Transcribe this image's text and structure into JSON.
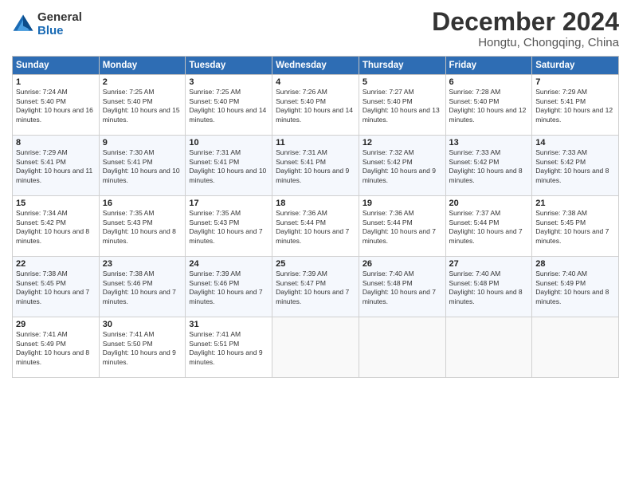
{
  "header": {
    "logo_general": "General",
    "logo_blue": "Blue",
    "title": "December 2024",
    "subtitle": "Hongtu, Chongqing, China"
  },
  "days_of_week": [
    "Sunday",
    "Monday",
    "Tuesday",
    "Wednesday",
    "Thursday",
    "Friday",
    "Saturday"
  ],
  "weeks": [
    [
      {
        "day": "1",
        "sunrise": "Sunrise: 7:24 AM",
        "sunset": "Sunset: 5:40 PM",
        "daylight": "Daylight: 10 hours and 16 minutes."
      },
      {
        "day": "2",
        "sunrise": "Sunrise: 7:25 AM",
        "sunset": "Sunset: 5:40 PM",
        "daylight": "Daylight: 10 hours and 15 minutes."
      },
      {
        "day": "3",
        "sunrise": "Sunrise: 7:25 AM",
        "sunset": "Sunset: 5:40 PM",
        "daylight": "Daylight: 10 hours and 14 minutes."
      },
      {
        "day": "4",
        "sunrise": "Sunrise: 7:26 AM",
        "sunset": "Sunset: 5:40 PM",
        "daylight": "Daylight: 10 hours and 14 minutes."
      },
      {
        "day": "5",
        "sunrise": "Sunrise: 7:27 AM",
        "sunset": "Sunset: 5:40 PM",
        "daylight": "Daylight: 10 hours and 13 minutes."
      },
      {
        "day": "6",
        "sunrise": "Sunrise: 7:28 AM",
        "sunset": "Sunset: 5:40 PM",
        "daylight": "Daylight: 10 hours and 12 minutes."
      },
      {
        "day": "7",
        "sunrise": "Sunrise: 7:29 AM",
        "sunset": "Sunset: 5:41 PM",
        "daylight": "Daylight: 10 hours and 12 minutes."
      }
    ],
    [
      {
        "day": "8",
        "sunrise": "Sunrise: 7:29 AM",
        "sunset": "Sunset: 5:41 PM",
        "daylight": "Daylight: 10 hours and 11 minutes."
      },
      {
        "day": "9",
        "sunrise": "Sunrise: 7:30 AM",
        "sunset": "Sunset: 5:41 PM",
        "daylight": "Daylight: 10 hours and 10 minutes."
      },
      {
        "day": "10",
        "sunrise": "Sunrise: 7:31 AM",
        "sunset": "Sunset: 5:41 PM",
        "daylight": "Daylight: 10 hours and 10 minutes."
      },
      {
        "day": "11",
        "sunrise": "Sunrise: 7:31 AM",
        "sunset": "Sunset: 5:41 PM",
        "daylight": "Daylight: 10 hours and 9 minutes."
      },
      {
        "day": "12",
        "sunrise": "Sunrise: 7:32 AM",
        "sunset": "Sunset: 5:42 PM",
        "daylight": "Daylight: 10 hours and 9 minutes."
      },
      {
        "day": "13",
        "sunrise": "Sunrise: 7:33 AM",
        "sunset": "Sunset: 5:42 PM",
        "daylight": "Daylight: 10 hours and 8 minutes."
      },
      {
        "day": "14",
        "sunrise": "Sunrise: 7:33 AM",
        "sunset": "Sunset: 5:42 PM",
        "daylight": "Daylight: 10 hours and 8 minutes."
      }
    ],
    [
      {
        "day": "15",
        "sunrise": "Sunrise: 7:34 AM",
        "sunset": "Sunset: 5:42 PM",
        "daylight": "Daylight: 10 hours and 8 minutes."
      },
      {
        "day": "16",
        "sunrise": "Sunrise: 7:35 AM",
        "sunset": "Sunset: 5:43 PM",
        "daylight": "Daylight: 10 hours and 8 minutes."
      },
      {
        "day": "17",
        "sunrise": "Sunrise: 7:35 AM",
        "sunset": "Sunset: 5:43 PM",
        "daylight": "Daylight: 10 hours and 7 minutes."
      },
      {
        "day": "18",
        "sunrise": "Sunrise: 7:36 AM",
        "sunset": "Sunset: 5:44 PM",
        "daylight": "Daylight: 10 hours and 7 minutes."
      },
      {
        "day": "19",
        "sunrise": "Sunrise: 7:36 AM",
        "sunset": "Sunset: 5:44 PM",
        "daylight": "Daylight: 10 hours and 7 minutes."
      },
      {
        "day": "20",
        "sunrise": "Sunrise: 7:37 AM",
        "sunset": "Sunset: 5:44 PM",
        "daylight": "Daylight: 10 hours and 7 minutes."
      },
      {
        "day": "21",
        "sunrise": "Sunrise: 7:38 AM",
        "sunset": "Sunset: 5:45 PM",
        "daylight": "Daylight: 10 hours and 7 minutes."
      }
    ],
    [
      {
        "day": "22",
        "sunrise": "Sunrise: 7:38 AM",
        "sunset": "Sunset: 5:45 PM",
        "daylight": "Daylight: 10 hours and 7 minutes."
      },
      {
        "day": "23",
        "sunrise": "Sunrise: 7:38 AM",
        "sunset": "Sunset: 5:46 PM",
        "daylight": "Daylight: 10 hours and 7 minutes."
      },
      {
        "day": "24",
        "sunrise": "Sunrise: 7:39 AM",
        "sunset": "Sunset: 5:46 PM",
        "daylight": "Daylight: 10 hours and 7 minutes."
      },
      {
        "day": "25",
        "sunrise": "Sunrise: 7:39 AM",
        "sunset": "Sunset: 5:47 PM",
        "daylight": "Daylight: 10 hours and 7 minutes."
      },
      {
        "day": "26",
        "sunrise": "Sunrise: 7:40 AM",
        "sunset": "Sunset: 5:48 PM",
        "daylight": "Daylight: 10 hours and 7 minutes."
      },
      {
        "day": "27",
        "sunrise": "Sunrise: 7:40 AM",
        "sunset": "Sunset: 5:48 PM",
        "daylight": "Daylight: 10 hours and 8 minutes."
      },
      {
        "day": "28",
        "sunrise": "Sunrise: 7:40 AM",
        "sunset": "Sunset: 5:49 PM",
        "daylight": "Daylight: 10 hours and 8 minutes."
      }
    ],
    [
      {
        "day": "29",
        "sunrise": "Sunrise: 7:41 AM",
        "sunset": "Sunset: 5:49 PM",
        "daylight": "Daylight: 10 hours and 8 minutes."
      },
      {
        "day": "30",
        "sunrise": "Sunrise: 7:41 AM",
        "sunset": "Sunset: 5:50 PM",
        "daylight": "Daylight: 10 hours and 9 minutes."
      },
      {
        "day": "31",
        "sunrise": "Sunrise: 7:41 AM",
        "sunset": "Sunset: 5:51 PM",
        "daylight": "Daylight: 10 hours and 9 minutes."
      },
      null,
      null,
      null,
      null
    ]
  ]
}
